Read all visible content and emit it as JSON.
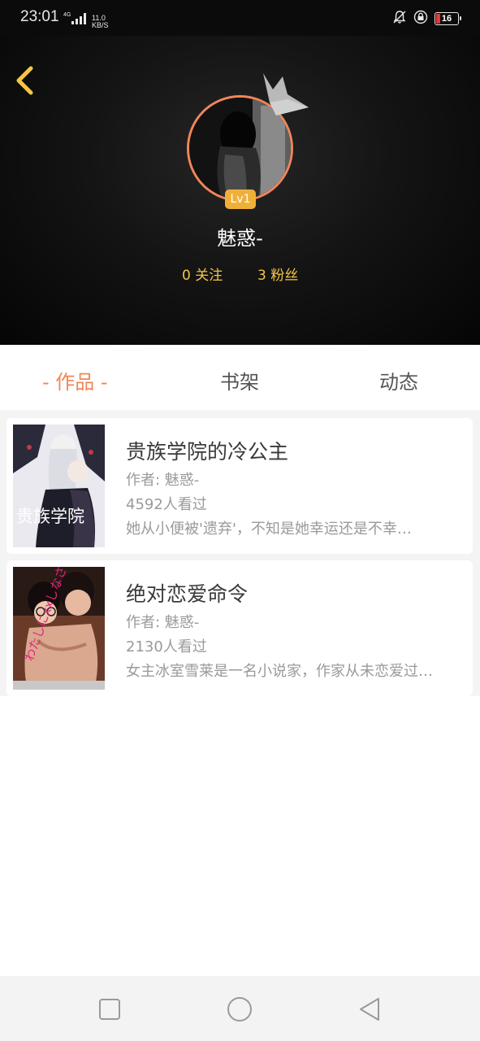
{
  "status_bar": {
    "time": "23:01",
    "network": "4G",
    "speed_value": "11.0",
    "speed_unit": "KB/S",
    "battery": "16"
  },
  "profile": {
    "level": "Lv1",
    "username": "魅惑-",
    "following": "0 关注",
    "followers": "3 粉丝"
  },
  "tabs": [
    {
      "label": "- 作品 -",
      "active": true
    },
    {
      "label": "书架",
      "active": false
    },
    {
      "label": "动态",
      "active": false
    }
  ],
  "books": [
    {
      "title": "贵族学院的冷公主",
      "author": "作者: 魅惑-",
      "views": "4592人看过",
      "description": "她从小便被'遗弃'，不知是她幸运还是不幸…",
      "cover_text": "贵族学院"
    },
    {
      "title": "绝对恋爱命令",
      "author": "作者: 魅惑-",
      "views": "2130人看过",
      "description": "女主冰室雪莱是一名小说家，作家从未恋爱过…",
      "cover_text": "わたしにxxしなさい!"
    }
  ],
  "colors": {
    "accent": "#f0865a",
    "level_badge": "#f0b038",
    "stats": "#f5c545",
    "back_arrow": "#f5c545"
  },
  "icons": {
    "back": "chevron-left-icon",
    "crown": "crown-icon",
    "nav_recent": "square-icon",
    "nav_home": "circle-icon",
    "nav_back": "triangle-back-icon"
  }
}
